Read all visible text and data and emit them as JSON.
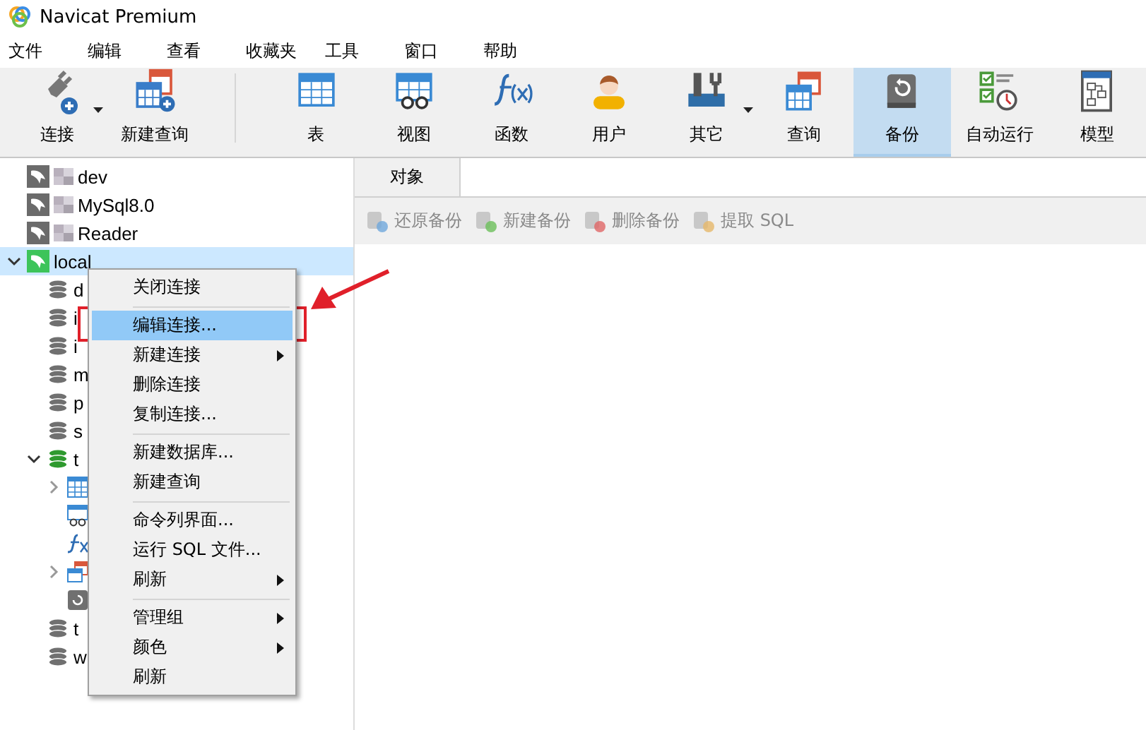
{
  "window": {
    "title": "Navicat Premium"
  },
  "menu_bar": [
    "文件",
    "编辑",
    "查看",
    "收藏夹",
    "工具",
    "窗口",
    "帮助"
  ],
  "toolbar": [
    {
      "kind": "connect",
      "label": "连接",
      "dropdown": true,
      "selected": false
    },
    {
      "kind": "new-query",
      "label": "新建查询",
      "dropdown": false,
      "selected": false
    },
    {
      "kind": "separator"
    },
    {
      "kind": "table",
      "label": "表",
      "dropdown": false,
      "selected": false
    },
    {
      "kind": "view",
      "label": "视图",
      "dropdown": false,
      "selected": false
    },
    {
      "kind": "function",
      "label": "函数",
      "dropdown": false,
      "selected": false
    },
    {
      "kind": "user",
      "label": "用户",
      "dropdown": false,
      "selected": false
    },
    {
      "kind": "other",
      "label": "其它",
      "dropdown": true,
      "selected": false
    },
    {
      "kind": "query",
      "label": "查询",
      "dropdown": false,
      "selected": false
    },
    {
      "kind": "backup",
      "label": "备份",
      "dropdown": false,
      "selected": true
    },
    {
      "kind": "schedule",
      "label": "自动运行",
      "dropdown": false,
      "selected": false
    },
    {
      "kind": "model",
      "label": "模型",
      "dropdown": false,
      "selected": false
    }
  ],
  "tree": [
    {
      "kind": "connection",
      "label": "dev",
      "open": false,
      "masked": true,
      "selected": false
    },
    {
      "kind": "connection",
      "label": "MySql8.0",
      "open": false,
      "masked": true,
      "selected": false
    },
    {
      "kind": "connection",
      "label": "Reader",
      "open": false,
      "masked": true,
      "selected": false
    },
    {
      "kind": "connection",
      "label": "local",
      "open": true,
      "selected": true,
      "expanded": true,
      "children": [
        {
          "kind": "database",
          "label": "d",
          "open": false,
          "selected": false
        },
        {
          "kind": "database",
          "label": "i",
          "open": false,
          "selected": false
        },
        {
          "kind": "database",
          "label": "i",
          "open": false,
          "selected": false
        },
        {
          "kind": "database",
          "label": "m",
          "open": false,
          "selected": false
        },
        {
          "kind": "database",
          "label": "p",
          "open": false,
          "selected": false
        },
        {
          "kind": "database",
          "label": "s",
          "open": false,
          "selected": false
        },
        {
          "kind": "database",
          "label": "t",
          "open": true,
          "selected": false,
          "expanded": true,
          "children": [
            {
              "kind": "table",
              "selected": false,
              "expanded": false
            },
            {
              "kind": "view",
              "selected": false
            },
            {
              "kind": "function",
              "selected": false
            },
            {
              "kind": "query",
              "selected": false,
              "expanded": false
            },
            {
              "kind": "backup",
              "selected": false
            }
          ]
        },
        {
          "kind": "database",
          "label": "t",
          "open": false,
          "selected": false
        },
        {
          "kind": "database",
          "label": "w",
          "open": false,
          "selected": false
        }
      ]
    }
  ],
  "tabs": [
    {
      "label": "对象",
      "selected": true
    }
  ],
  "object_toolbar": [
    {
      "kind": "restore",
      "label": "还原备份",
      "disabled": true
    },
    {
      "kind": "new",
      "label": "新建备份",
      "disabled": true
    },
    {
      "kind": "delete",
      "label": "删除备份",
      "disabled": true
    },
    {
      "kind": "extract",
      "label": "提取 SQL",
      "disabled": true
    }
  ],
  "context_menu": [
    {
      "kind": "item",
      "label": "关闭连接",
      "selected": false,
      "submenu": false
    },
    {
      "kind": "separator"
    },
    {
      "kind": "item",
      "label": "编辑连接...",
      "selected": true,
      "submenu": false
    },
    {
      "kind": "item",
      "label": "新建连接",
      "selected": false,
      "submenu": true
    },
    {
      "kind": "item",
      "label": "删除连接",
      "selected": false,
      "submenu": false
    },
    {
      "kind": "item",
      "label": "复制连接...",
      "selected": false,
      "submenu": false
    },
    {
      "kind": "separator"
    },
    {
      "kind": "item",
      "label": "新建数据库...",
      "selected": false,
      "submenu": false
    },
    {
      "kind": "item",
      "label": "新建查询",
      "selected": false,
      "submenu": false
    },
    {
      "kind": "separator"
    },
    {
      "kind": "item",
      "label": "命令列界面...",
      "selected": false,
      "submenu": false
    },
    {
      "kind": "item",
      "label": "运行 SQL 文件...",
      "selected": false,
      "submenu": false
    },
    {
      "kind": "item",
      "label": "刷新",
      "selected": false,
      "submenu": true
    },
    {
      "kind": "separator"
    },
    {
      "kind": "item",
      "label": "管理组",
      "selected": false,
      "submenu": true
    },
    {
      "kind": "item",
      "label": "颜色",
      "selected": false,
      "submenu": true
    },
    {
      "kind": "item",
      "label": "刷新",
      "selected": false,
      "submenu": false
    }
  ]
}
